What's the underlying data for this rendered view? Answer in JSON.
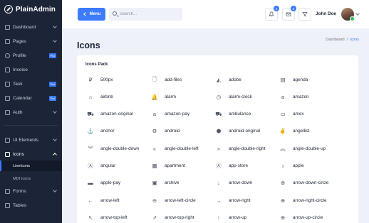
{
  "brand": {
    "name": "PlainAdmin"
  },
  "sidebar": {
    "items": [
      {
        "label": "Dashboard",
        "icon": "dashboard-icon",
        "suffix": "chevron"
      },
      {
        "label": "Pages",
        "icon": "pages-icon",
        "suffix": "chevron"
      },
      {
        "label": "Profile",
        "icon": "user-icon",
        "suffix": "pro"
      },
      {
        "label": "Invoice",
        "icon": "invoice-icon",
        "suffix": ""
      },
      {
        "label": "Task",
        "icon": "task-icon",
        "suffix": "pro"
      },
      {
        "label": "Calendar",
        "icon": "calendar-icon",
        "suffix": "pro"
      },
      {
        "label": "Auth",
        "icon": "lock-icon",
        "suffix": "chevron"
      },
      {
        "label": "UI Elements",
        "icon": "ui-elements-icon",
        "suffix": "chevron"
      },
      {
        "label": "Icons",
        "icon": "icons-icon",
        "suffix": "chevron-up"
      },
      {
        "label": "Forms",
        "icon": "forms-icon",
        "suffix": "chevron"
      },
      {
        "label": "Tables",
        "icon": "tables-icon",
        "suffix": ""
      }
    ],
    "sub_items": [
      {
        "label": "LineIcons",
        "active": true
      },
      {
        "label": "MDI Icons",
        "active": false
      }
    ],
    "pro_label": "Pro"
  },
  "header": {
    "menu_label": "Menu",
    "search_placeholder": "Search...",
    "notifications_count": "2",
    "messages_count": "3",
    "user_name": "John Doe"
  },
  "page": {
    "title": "Icons",
    "breadcrumb": [
      "Dashboard",
      "/",
      "Icons"
    ]
  },
  "card": {
    "title": "Icons Pack",
    "icons": [
      {
        "name": "500px",
        "glyph": "₽"
      },
      {
        "name": "add-files",
        "glyph": "🗋"
      },
      {
        "name": "adobe",
        "glyph": "◭"
      },
      {
        "name": "agenda",
        "glyph": "▤"
      },
      {
        "name": "airbnb",
        "glyph": "⌂"
      },
      {
        "name": "alarm",
        "glyph": "🔔"
      },
      {
        "name": "alarm-clock",
        "glyph": "◷"
      },
      {
        "name": "amazon",
        "glyph": "a"
      },
      {
        "name": "amazon-original",
        "glyph": "⛟"
      },
      {
        "name": "amazon-pay",
        "glyph": "a"
      },
      {
        "name": "ambulance",
        "glyph": "⛟"
      },
      {
        "name": "amex",
        "glyph": "▭"
      },
      {
        "name": "anchor",
        "glyph": "⚓"
      },
      {
        "name": "android",
        "glyph": "⚙"
      },
      {
        "name": "android-original",
        "glyph": "⬢"
      },
      {
        "name": "angellist",
        "glyph": "✌"
      },
      {
        "name": "angle-double-down",
        "glyph": "︾"
      },
      {
        "name": "angle-double-left",
        "glyph": "«"
      },
      {
        "name": "angle-double-right",
        "glyph": "»"
      },
      {
        "name": "angle-double-up",
        "glyph": "︽"
      },
      {
        "name": "angular",
        "glyph": "Ⓐ"
      },
      {
        "name": "apartment",
        "glyph": "▦"
      },
      {
        "name": "app-store",
        "glyph": "Ⓐ"
      },
      {
        "name": "apple",
        "glyph": "♁"
      },
      {
        "name": "apple-pay",
        "glyph": "▬"
      },
      {
        "name": "archive",
        "glyph": "▣"
      },
      {
        "name": "arrow-down",
        "glyph": "↓"
      },
      {
        "name": "arrow-down-circle",
        "glyph": "⊕"
      },
      {
        "name": "arrow-left",
        "glyph": "←"
      },
      {
        "name": "arrow-left-circle",
        "glyph": "⊖"
      },
      {
        "name": "arrow-right",
        "glyph": "→"
      },
      {
        "name": "arrow-right-circle",
        "glyph": "⊕"
      },
      {
        "name": "arrow-top-left",
        "glyph": "↖"
      },
      {
        "name": "arrow-top-right",
        "glyph": "↗"
      },
      {
        "name": "arrow-up",
        "glyph": "↑"
      },
      {
        "name": "arrow-up-circle",
        "glyph": "⊕"
      }
    ]
  },
  "colors": {
    "accent": "#3d7bff",
    "sidebar_bg": "#1c2437",
    "page_bg": "#eef1f7",
    "online": "#22c55e"
  }
}
